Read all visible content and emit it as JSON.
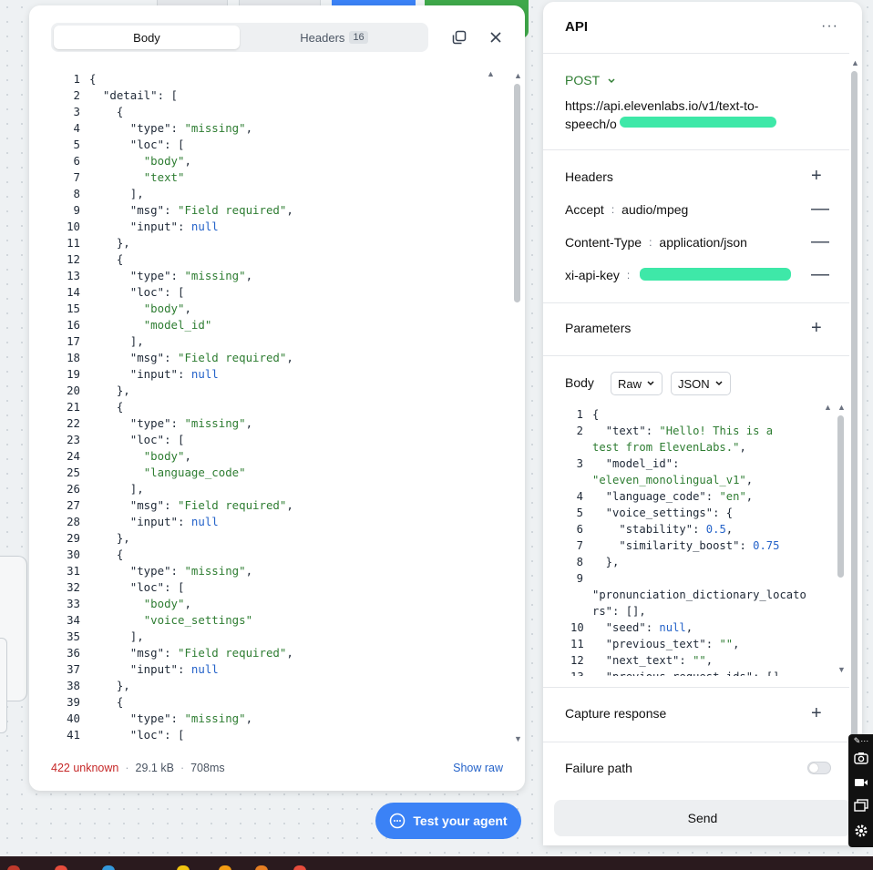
{
  "response_panel": {
    "tabs": {
      "body": "Body",
      "headers": "Headers",
      "headers_count": "16"
    },
    "code_lines": [
      [
        {
          "t": "p",
          "v": "{"
        }
      ],
      [
        {
          "t": "p",
          "v": "  "
        },
        {
          "t": "k",
          "v": "\"detail\""
        },
        {
          "t": "p",
          "v": ": ["
        }
      ],
      [
        {
          "t": "p",
          "v": "    {"
        }
      ],
      [
        {
          "t": "p",
          "v": "      "
        },
        {
          "t": "k",
          "v": "\"type\""
        },
        {
          "t": "p",
          "v": ": "
        },
        {
          "t": "s",
          "v": "\"missing\""
        },
        {
          "t": "p",
          "v": ","
        }
      ],
      [
        {
          "t": "p",
          "v": "      "
        },
        {
          "t": "k",
          "v": "\"loc\""
        },
        {
          "t": "p",
          "v": ": ["
        }
      ],
      [
        {
          "t": "p",
          "v": "        "
        },
        {
          "t": "s",
          "v": "\"body\""
        },
        {
          "t": "p",
          "v": ","
        }
      ],
      [
        {
          "t": "p",
          "v": "        "
        },
        {
          "t": "s",
          "v": "\"text\""
        }
      ],
      [
        {
          "t": "p",
          "v": "      ],"
        }
      ],
      [
        {
          "t": "p",
          "v": "      "
        },
        {
          "t": "k",
          "v": "\"msg\""
        },
        {
          "t": "p",
          "v": ": "
        },
        {
          "t": "s",
          "v": "\"Field required\""
        },
        {
          "t": "p",
          "v": ","
        }
      ],
      [
        {
          "t": "p",
          "v": "      "
        },
        {
          "t": "k",
          "v": "\"input\""
        },
        {
          "t": "p",
          "v": ": "
        },
        {
          "t": "w",
          "v": "null"
        }
      ],
      [
        {
          "t": "p",
          "v": "    },"
        }
      ],
      [
        {
          "t": "p",
          "v": "    {"
        }
      ],
      [
        {
          "t": "p",
          "v": "      "
        },
        {
          "t": "k",
          "v": "\"type\""
        },
        {
          "t": "p",
          "v": ": "
        },
        {
          "t": "s",
          "v": "\"missing\""
        },
        {
          "t": "p",
          "v": ","
        }
      ],
      [
        {
          "t": "p",
          "v": "      "
        },
        {
          "t": "k",
          "v": "\"loc\""
        },
        {
          "t": "p",
          "v": ": ["
        }
      ],
      [
        {
          "t": "p",
          "v": "        "
        },
        {
          "t": "s",
          "v": "\"body\""
        },
        {
          "t": "p",
          "v": ","
        }
      ],
      [
        {
          "t": "p",
          "v": "        "
        },
        {
          "t": "s",
          "v": "\"model_id\""
        }
      ],
      [
        {
          "t": "p",
          "v": "      ],"
        }
      ],
      [
        {
          "t": "p",
          "v": "      "
        },
        {
          "t": "k",
          "v": "\"msg\""
        },
        {
          "t": "p",
          "v": ": "
        },
        {
          "t": "s",
          "v": "\"Field required\""
        },
        {
          "t": "p",
          "v": ","
        }
      ],
      [
        {
          "t": "p",
          "v": "      "
        },
        {
          "t": "k",
          "v": "\"input\""
        },
        {
          "t": "p",
          "v": ": "
        },
        {
          "t": "w",
          "v": "null"
        }
      ],
      [
        {
          "t": "p",
          "v": "    },"
        }
      ],
      [
        {
          "t": "p",
          "v": "    {"
        }
      ],
      [
        {
          "t": "p",
          "v": "      "
        },
        {
          "t": "k",
          "v": "\"type\""
        },
        {
          "t": "p",
          "v": ": "
        },
        {
          "t": "s",
          "v": "\"missing\""
        },
        {
          "t": "p",
          "v": ","
        }
      ],
      [
        {
          "t": "p",
          "v": "      "
        },
        {
          "t": "k",
          "v": "\"loc\""
        },
        {
          "t": "p",
          "v": ": ["
        }
      ],
      [
        {
          "t": "p",
          "v": "        "
        },
        {
          "t": "s",
          "v": "\"body\""
        },
        {
          "t": "p",
          "v": ","
        }
      ],
      [
        {
          "t": "p",
          "v": "        "
        },
        {
          "t": "s",
          "v": "\"language_code\""
        }
      ],
      [
        {
          "t": "p",
          "v": "      ],"
        }
      ],
      [
        {
          "t": "p",
          "v": "      "
        },
        {
          "t": "k",
          "v": "\"msg\""
        },
        {
          "t": "p",
          "v": ": "
        },
        {
          "t": "s",
          "v": "\"Field required\""
        },
        {
          "t": "p",
          "v": ","
        }
      ],
      [
        {
          "t": "p",
          "v": "      "
        },
        {
          "t": "k",
          "v": "\"input\""
        },
        {
          "t": "p",
          "v": ": "
        },
        {
          "t": "w",
          "v": "null"
        }
      ],
      [
        {
          "t": "p",
          "v": "    },"
        }
      ],
      [
        {
          "t": "p",
          "v": "    {"
        }
      ],
      [
        {
          "t": "p",
          "v": "      "
        },
        {
          "t": "k",
          "v": "\"type\""
        },
        {
          "t": "p",
          "v": ": "
        },
        {
          "t": "s",
          "v": "\"missing\""
        },
        {
          "t": "p",
          "v": ","
        }
      ],
      [
        {
          "t": "p",
          "v": "      "
        },
        {
          "t": "k",
          "v": "\"loc\""
        },
        {
          "t": "p",
          "v": ": ["
        }
      ],
      [
        {
          "t": "p",
          "v": "        "
        },
        {
          "t": "s",
          "v": "\"body\""
        },
        {
          "t": "p",
          "v": ","
        }
      ],
      [
        {
          "t": "p",
          "v": "        "
        },
        {
          "t": "s",
          "v": "\"voice_settings\""
        }
      ],
      [
        {
          "t": "p",
          "v": "      ],"
        }
      ],
      [
        {
          "t": "p",
          "v": "      "
        },
        {
          "t": "k",
          "v": "\"msg\""
        },
        {
          "t": "p",
          "v": ": "
        },
        {
          "t": "s",
          "v": "\"Field required\""
        },
        {
          "t": "p",
          "v": ","
        }
      ],
      [
        {
          "t": "p",
          "v": "      "
        },
        {
          "t": "k",
          "v": "\"input\""
        },
        {
          "t": "p",
          "v": ": "
        },
        {
          "t": "w",
          "v": "null"
        }
      ],
      [
        {
          "t": "p",
          "v": "    },"
        }
      ],
      [
        {
          "t": "p",
          "v": "    {"
        }
      ],
      [
        {
          "t": "p",
          "v": "      "
        },
        {
          "t": "k",
          "v": "\"type\""
        },
        {
          "t": "p",
          "v": ": "
        },
        {
          "t": "s",
          "v": "\"missing\""
        },
        {
          "t": "p",
          "v": ","
        }
      ],
      [
        {
          "t": "p",
          "v": "      "
        },
        {
          "t": "k",
          "v": "\"loc\""
        },
        {
          "t": "p",
          "v": ": ["
        }
      ]
    ],
    "footer": {
      "status": "422 unknown",
      "size": "29.1 kB",
      "time": "708ms",
      "show_raw": "Show raw"
    }
  },
  "test_agent_button": "Test your agent",
  "api_panel": {
    "title": "API",
    "more": "···",
    "method": "POST",
    "url": "https://api.elevenlabs.io/v1/text-to-speech/o",
    "headers_label": "Headers",
    "headers": [
      {
        "key": "Accept",
        "value": "audio/mpeg"
      },
      {
        "key": "Content-Type",
        "value": "application/json"
      },
      {
        "key": "xi-api-key",
        "value": ""
      }
    ],
    "parameters_label": "Parameters",
    "body_label": "Body",
    "body_mode": "Raw",
    "body_format": "JSON",
    "body_lines": [
      {
        "n": "1",
        "parts": [
          {
            "t": "p",
            "v": "{"
          }
        ]
      },
      {
        "n": "2",
        "parts": [
          {
            "t": "p",
            "v": "  "
          },
          {
            "t": "k",
            "v": "\"text\""
          },
          {
            "t": "p",
            "v": ": "
          },
          {
            "t": "s",
            "v": "\"Hello! This is a"
          }
        ]
      },
      {
        "n": "",
        "parts": [
          {
            "t": "s",
            "v": "test from ElevenLabs.\""
          },
          {
            "t": "p",
            "v": ","
          }
        ]
      },
      {
        "n": "3",
        "parts": [
          {
            "t": "p",
            "v": "  "
          },
          {
            "t": "k",
            "v": "\"model_id\""
          },
          {
            "t": "p",
            "v": ":"
          }
        ]
      },
      {
        "n": "",
        "parts": [
          {
            "t": "s",
            "v": "\"eleven_monolingual_v1\""
          },
          {
            "t": "p",
            "v": ","
          }
        ]
      },
      {
        "n": "4",
        "parts": [
          {
            "t": "p",
            "v": "  "
          },
          {
            "t": "k",
            "v": "\"language_code\""
          },
          {
            "t": "p",
            "v": ": "
          },
          {
            "t": "s",
            "v": "\"en\""
          },
          {
            "t": "p",
            "v": ","
          }
        ]
      },
      {
        "n": "5",
        "parts": [
          {
            "t": "p",
            "v": "  "
          },
          {
            "t": "k",
            "v": "\"voice_settings\""
          },
          {
            "t": "p",
            "v": ": {"
          }
        ]
      },
      {
        "n": "6",
        "parts": [
          {
            "t": "p",
            "v": "    "
          },
          {
            "t": "k",
            "v": "\"stability\""
          },
          {
            "t": "p",
            "v": ": "
          },
          {
            "t": "w",
            "v": "0.5"
          },
          {
            "t": "p",
            "v": ","
          }
        ]
      },
      {
        "n": "7",
        "parts": [
          {
            "t": "p",
            "v": "    "
          },
          {
            "t": "k",
            "v": "\"similarity_boost\""
          },
          {
            "t": "p",
            "v": ": "
          },
          {
            "t": "w",
            "v": "0.75"
          }
        ]
      },
      {
        "n": "8",
        "parts": [
          {
            "t": "p",
            "v": "  },"
          }
        ]
      },
      {
        "n": "9",
        "parts": [
          {
            "t": "p",
            "v": ""
          }
        ]
      },
      {
        "n": "",
        "parts": [
          {
            "t": "k",
            "v": "\"pronunciation_dictionary_locato"
          }
        ]
      },
      {
        "n": "",
        "parts": [
          {
            "t": "k",
            "v": "rs\""
          },
          {
            "t": "p",
            "v": ": [],"
          }
        ]
      },
      {
        "n": "10",
        "parts": [
          {
            "t": "p",
            "v": "  "
          },
          {
            "t": "k",
            "v": "\"seed\""
          },
          {
            "t": "p",
            "v": ": "
          },
          {
            "t": "w",
            "v": "null"
          },
          {
            "t": "p",
            "v": ","
          }
        ]
      },
      {
        "n": "11",
        "parts": [
          {
            "t": "p",
            "v": "  "
          },
          {
            "t": "k",
            "v": "\"previous_text\""
          },
          {
            "t": "p",
            "v": ": "
          },
          {
            "t": "s",
            "v": "\"\""
          },
          {
            "t": "p",
            "v": ","
          }
        ]
      },
      {
        "n": "12",
        "parts": [
          {
            "t": "p",
            "v": "  "
          },
          {
            "t": "k",
            "v": "\"next_text\""
          },
          {
            "t": "p",
            "v": ": "
          },
          {
            "t": "s",
            "v": "\"\""
          },
          {
            "t": "p",
            "v": ","
          }
        ]
      },
      {
        "n": "13",
        "parts": [
          {
            "t": "p",
            "v": "  "
          },
          {
            "t": "k",
            "v": "\"previous_request_ids\""
          },
          {
            "t": "p",
            "v": ": []"
          }
        ]
      }
    ],
    "capture_response_label": "Capture response",
    "failure_path_label": "Failure path",
    "failure_path_enabled": false,
    "send_label": "Send"
  },
  "colors": {
    "string": "#2e7d32",
    "keyword": "#2563c9",
    "status_error": "#c62828",
    "accent_blue": "#3b82f6",
    "redaction": "#3ee8a8"
  }
}
